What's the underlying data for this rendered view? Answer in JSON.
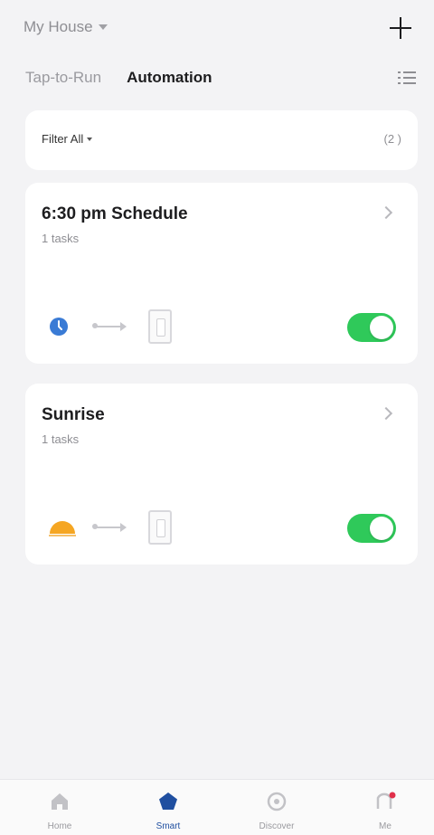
{
  "header": {
    "house_selector": "My House",
    "add_icon": "plus-icon"
  },
  "tabs": [
    {
      "label": "Tap-to-Run",
      "active": false
    },
    {
      "label": "Automation",
      "active": true
    }
  ],
  "filter": {
    "label": "Filter All",
    "count": "(2 )"
  },
  "automations": [
    {
      "title": "6:30 pm Schedule",
      "subtitle": "1 tasks",
      "condition_icon": "clock-icon",
      "action_icon": "wall-switch-icon",
      "enabled": true
    },
    {
      "title": "Sunrise",
      "subtitle": "1 tasks",
      "condition_icon": "sunrise-icon",
      "action_icon": "wall-switch-icon",
      "enabled": true
    }
  ],
  "tabbar": [
    {
      "label": "Home",
      "icon": "home-icon",
      "active": false
    },
    {
      "label": "Smart",
      "icon": "smart-pentagon-icon",
      "active": true
    },
    {
      "label": "Discover",
      "icon": "discover-icon",
      "active": false
    },
    {
      "label": "Me",
      "icon": "me-icon",
      "active": false
    }
  ],
  "colors": {
    "toggle_on": "#2fc95a",
    "active_tab": "#1f4fa0",
    "clock": "#3a7bd5",
    "sunrise": "#f5a623",
    "notification_dot": "#e0304a"
  }
}
